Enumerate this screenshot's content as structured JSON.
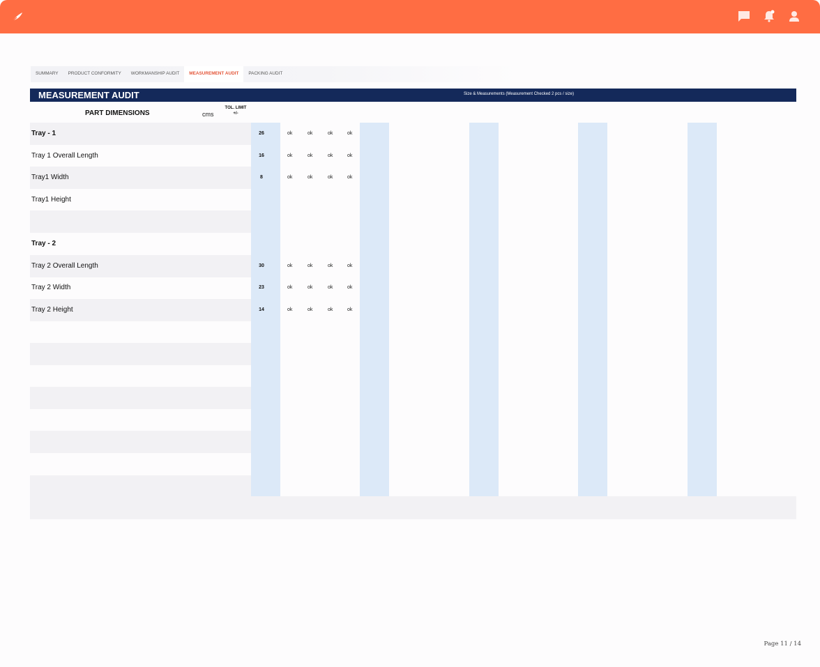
{
  "tabs": [
    {
      "label": "SUMMARY",
      "active": false
    },
    {
      "label": "PRODUCT CONFORMITY",
      "active": false
    },
    {
      "label": "WORKMANSHIP AUDIT",
      "active": false
    },
    {
      "label": "MEASUREMENT AUDIT",
      "active": true
    },
    {
      "label": "PACKING AUDIT",
      "active": false
    }
  ],
  "header": {
    "title": "MEASUREMENT AUDIT",
    "subtitle": "Size & Measurements  (Measurement Checked 2 pcs / size)"
  },
  "columns": {
    "part": "PART DIMENSIONS",
    "unit": "cms",
    "tol_line1": "TOL. LIMIT",
    "tol_line2": "+/-"
  },
  "rows": [
    {
      "label": "Tray - 1",
      "bold": true,
      "value": "26",
      "checks": [
        "ok",
        "ok",
        "ok",
        "ok"
      ]
    },
    {
      "label": "Tray 1 Overall Length",
      "bold": false,
      "value": "16",
      "checks": [
        "ok",
        "ok",
        "ok",
        "ok"
      ]
    },
    {
      "label": "Tray1 Width",
      "bold": false,
      "value": "8",
      "checks": [
        "ok",
        "ok",
        "ok",
        "ok"
      ]
    },
    {
      "label": "Tray1 Height",
      "bold": false,
      "value": "",
      "checks": []
    },
    {
      "label": "",
      "bold": false,
      "value": "",
      "checks": []
    },
    {
      "label": "Tray - 2",
      "bold": true,
      "value": "",
      "checks": []
    },
    {
      "label": "Tray 2 Overall Length",
      "bold": false,
      "value": "30",
      "checks": [
        "ok",
        "ok",
        "ok",
        "ok"
      ]
    },
    {
      "label": "Tray 2 Width",
      "bold": false,
      "value": "23",
      "checks": [
        "ok",
        "ok",
        "ok",
        "ok"
      ]
    },
    {
      "label": "Tray 2 Height",
      "bold": false,
      "value": "14",
      "checks": [
        "ok",
        "ok",
        "ok",
        "ok"
      ]
    },
    {
      "label": "",
      "bold": false,
      "value": "",
      "checks": []
    },
    {
      "label": "",
      "bold": false,
      "value": "",
      "checks": []
    },
    {
      "label": "",
      "bold": false,
      "value": "",
      "checks": []
    },
    {
      "label": "",
      "bold": false,
      "value": "",
      "checks": []
    },
    {
      "label": "",
      "bold": false,
      "value": "",
      "checks": []
    },
    {
      "label": "",
      "bold": false,
      "value": "",
      "checks": []
    },
    {
      "label": "",
      "bold": false,
      "value": "",
      "checks": []
    },
    {
      "label": "",
      "bold": false,
      "value": "",
      "checks": []
    }
  ],
  "footer": {
    "page_text": "Page  11  /  14"
  },
  "icons": {
    "logo": "feather-icon",
    "chat": "chat-icon",
    "notifications": "bell-icon",
    "user": "user-icon"
  },
  "colors": {
    "brand": "#ff6d43",
    "header": "#14295a",
    "highlight_column": "#dce9f8",
    "row_shade": "#f2f1f4",
    "active_tab": "#e4573a"
  }
}
